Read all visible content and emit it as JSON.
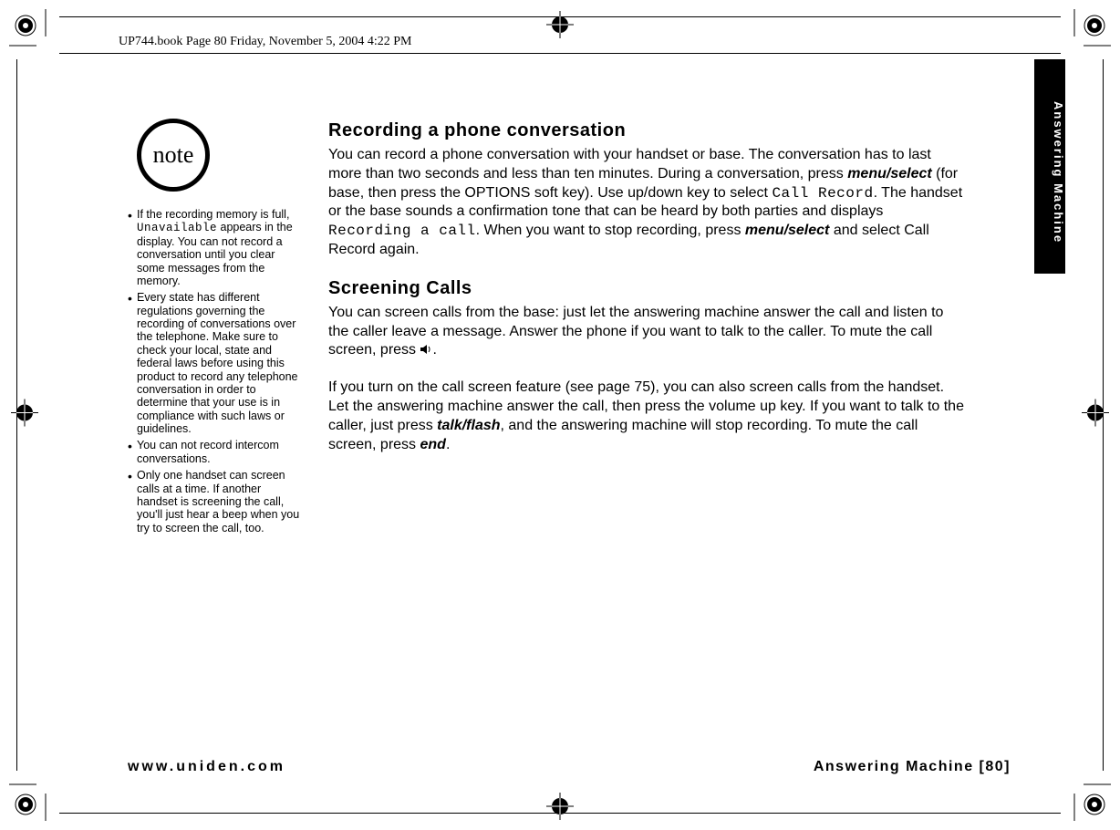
{
  "header_line": "UP744.book  Page 80  Friday, November 5, 2004  4:22 PM",
  "side_tab": "Answering Machine",
  "note_badge": "note",
  "notes": {
    "n1a": "If the recording memory is full, ",
    "n1_lcd": "Unavailable",
    "n1b": " appears in the display. You can not record a conversation until you clear some messages from the memory.",
    "n2": "Every state has different regulations governing the recording of conversations over the telephone. Make sure to check your local, state and federal laws before using this product to record any telephone conversation in order to determine that your use is in compliance with such laws or guidelines.",
    "n3": "You can not record intercom conversations.",
    "n4": "Only one handset can screen calls at a time. If another handset is screening the call, you'll just hear a beep when you try to screen the call, too."
  },
  "sec1_title": "Recording a phone conversation",
  "sec1": {
    "t1": "You can record a phone conversation with your handset or base. The conversation has to last more than two seconds and less than ten minutes. During a conversation, press ",
    "k1": "menu/select",
    "t2": " (for base, then press the OPTIONS soft key). Use up/down key to select ",
    "lcd1": "Call Record",
    "t3": ". The handset or the base sounds a confirmation tone that can be heard by both parties and displays ",
    "lcd2": "Recording a call",
    "t4": ". When you want to stop recording, press ",
    "k2": "menu/select",
    "t5": " and select Call Record again."
  },
  "sec2_title": "Screening Calls",
  "sec2": {
    "p1a": "You can screen calls from the base: just let the answering machine answer the call and listen to the caller leave a message. Answer the phone if you want to talk to the caller. To mute the call screen, press ",
    "p1b": ".",
    "p2a": "If you turn on the call screen feature (see page 75), you can also screen calls from the handset. Let the answering machine answer the call, then press the volume up key. If you want to talk to the caller, just press ",
    "k1": "talk/flash",
    "p2b": ", and the answering machine will stop recording. To mute the call screen, press ",
    "k2": "end",
    "p2c": "."
  },
  "footer_left": "www.uniden.com",
  "footer_right": "Answering Machine [80]"
}
